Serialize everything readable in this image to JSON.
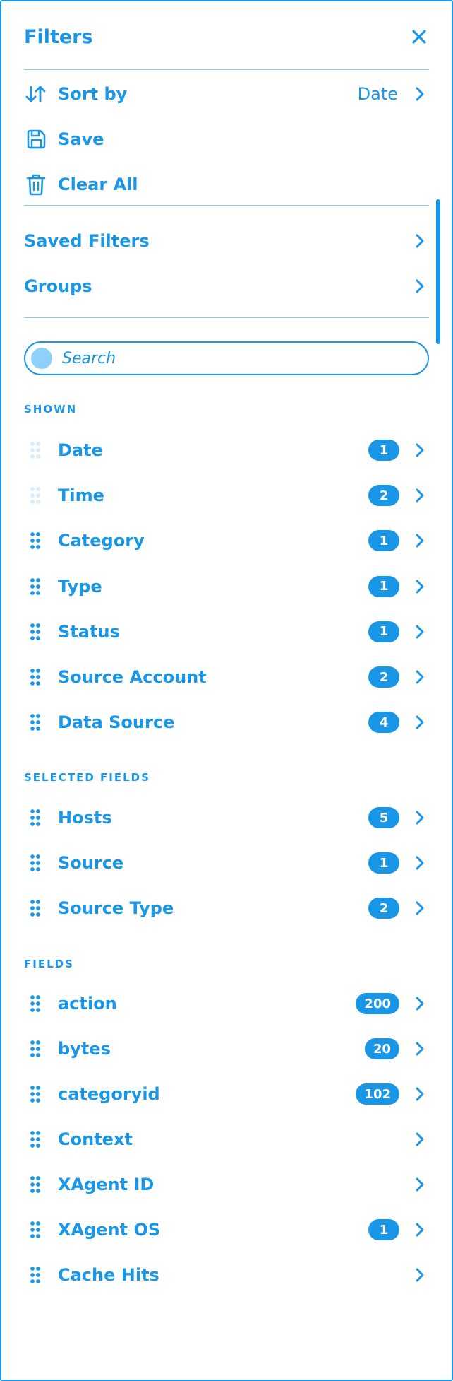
{
  "header": {
    "title": "Filters"
  },
  "actions": {
    "sort_label": "Sort by",
    "sort_value": "Date",
    "save_label": "Save",
    "clear_label": "Clear All"
  },
  "nav": {
    "saved_filters": "Saved Filters",
    "groups": "Groups"
  },
  "search": {
    "placeholder": "Search"
  },
  "sections": {
    "shown": "SHOWN",
    "selected": "SELECTED FIELDS",
    "fields": "FIELDS"
  },
  "shown": [
    {
      "label": "Date",
      "count": "1",
      "drag_disabled": true
    },
    {
      "label": "Time",
      "count": "2",
      "drag_disabled": true
    },
    {
      "label": "Category",
      "count": "1"
    },
    {
      "label": "Type",
      "count": "1"
    },
    {
      "label": "Status",
      "count": "1"
    },
    {
      "label": "Source Account",
      "count": "2"
    },
    {
      "label": "Data Source",
      "count": "4"
    }
  ],
  "selected": [
    {
      "label": "Hosts",
      "count": "5"
    },
    {
      "label": "Source",
      "count": "1"
    },
    {
      "label": "Source Type",
      "count": "2"
    }
  ],
  "fields": [
    {
      "label": "action",
      "count": "200"
    },
    {
      "label": "bytes",
      "count": "20"
    },
    {
      "label": "categoryid",
      "count": "102"
    },
    {
      "label": "Context",
      "count": ""
    },
    {
      "label": "XAgent ID",
      "count": ""
    },
    {
      "label": "XAgent OS",
      "count": "1"
    },
    {
      "label": "Cache Hits",
      "count": ""
    }
  ],
  "colors": {
    "accent": "#1a96e6",
    "divider": "#8ecdf0",
    "search_dot": "#8fd0fb",
    "grip_disabled": "#d4ecfb"
  }
}
